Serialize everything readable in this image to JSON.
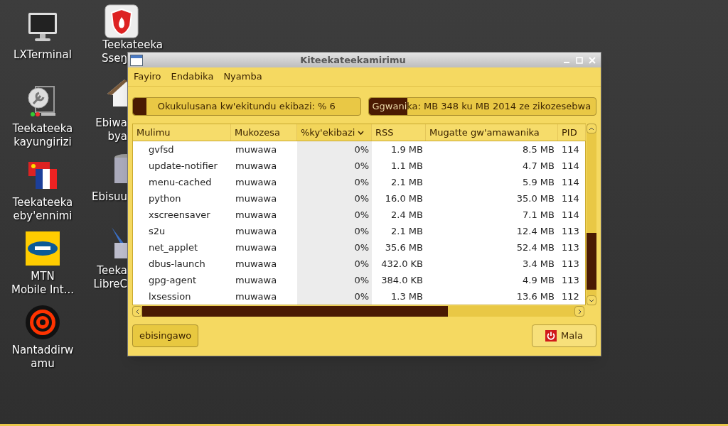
{
  "desktop_icons_left": [
    {
      "kind": "monitor",
      "lines": [
        "LXTerminal"
      ]
    },
    {
      "kind": "tool",
      "lines": [
        "Teekateeka",
        "kayungirizi"
      ]
    },
    {
      "kind": "flags",
      "lines": [
        "Teekateeka",
        "eby'ennimi"
      ]
    },
    {
      "kind": "mtn",
      "lines": [
        "MTN",
        "Mobile Int..."
      ]
    },
    {
      "kind": "target",
      "lines": [
        "Nantaddirw",
        "amu"
      ]
    }
  ],
  "desktop_icons_right": [
    {
      "kind": "shield",
      "lines": [
        "Teekateeka",
        "Sseŋ"
      ]
    },
    {
      "kind": "home",
      "lines": [
        "Ebiwa",
        "bya"
      ]
    },
    {
      "kind": "trash",
      "lines": [
        "Ebisuu"
      ]
    },
    {
      "kind": "pen",
      "lines": [
        "Teeka",
        "LibreC"
      ]
    }
  ],
  "window": {
    "title": "Kiteekateekamirimu",
    "menu": [
      "Fayiro",
      "Endabika",
      "Nyamba"
    ],
    "meters": [
      {
        "label": "Okukulusana kw'ekitundu ekibazi: % 6",
        "level": 0.06
      },
      {
        "label": "Ggwanika: MB 348 ku MB 2014 ze zikozesebwa",
        "level": 0.17
      }
    ],
    "table": {
      "columns": [
        {
          "label": "Mulimu",
          "selected": false
        },
        {
          "label": "Mukozesa",
          "selected": false
        },
        {
          "label": "%ky'ekibazi",
          "selected": true
        },
        {
          "label": "RSS",
          "selected": false
        },
        {
          "label": "Mugatte gw'amawanika",
          "selected": false
        },
        {
          "label": "PID",
          "selected": false
        }
      ],
      "rows": [
        [
          "gvfsd",
          "muwawa",
          "0%",
          "1.9 MB",
          "8.5 MB",
          "114"
        ],
        [
          "update-notifier",
          "muwawa",
          "0%",
          "1.1 MB",
          "4.7 MB",
          "114"
        ],
        [
          "menu-cached",
          "muwawa",
          "0%",
          "2.1 MB",
          "5.9 MB",
          "114"
        ],
        [
          "python",
          "muwawa",
          "0%",
          "16.0 MB",
          "35.0 MB",
          "114"
        ],
        [
          "xscreensaver",
          "muwawa",
          "0%",
          "2.4 MB",
          "7.1 MB",
          "114"
        ],
        [
          "s2u",
          "muwawa",
          "0%",
          "2.1 MB",
          "12.4 MB",
          "113"
        ],
        [
          "net_applet",
          "muwawa",
          "0%",
          "35.6 MB",
          "52.4 MB",
          "113"
        ],
        [
          "dbus-launch",
          "muwawa",
          "0%",
          "432.0 KB",
          "3.4 MB",
          "113"
        ],
        [
          "gpg-agent",
          "muwawa",
          "0%",
          "384.0 KB",
          "4.9 MB",
          "113"
        ],
        [
          "lxsession",
          "muwawa",
          "0%",
          "1.3 MB",
          "13.6 MB",
          "112"
        ]
      ]
    },
    "buttons": [
      {
        "kind": "plain",
        "label": "ebisingawo"
      },
      {
        "kind": "power",
        "label": "Mala"
      }
    ]
  }
}
